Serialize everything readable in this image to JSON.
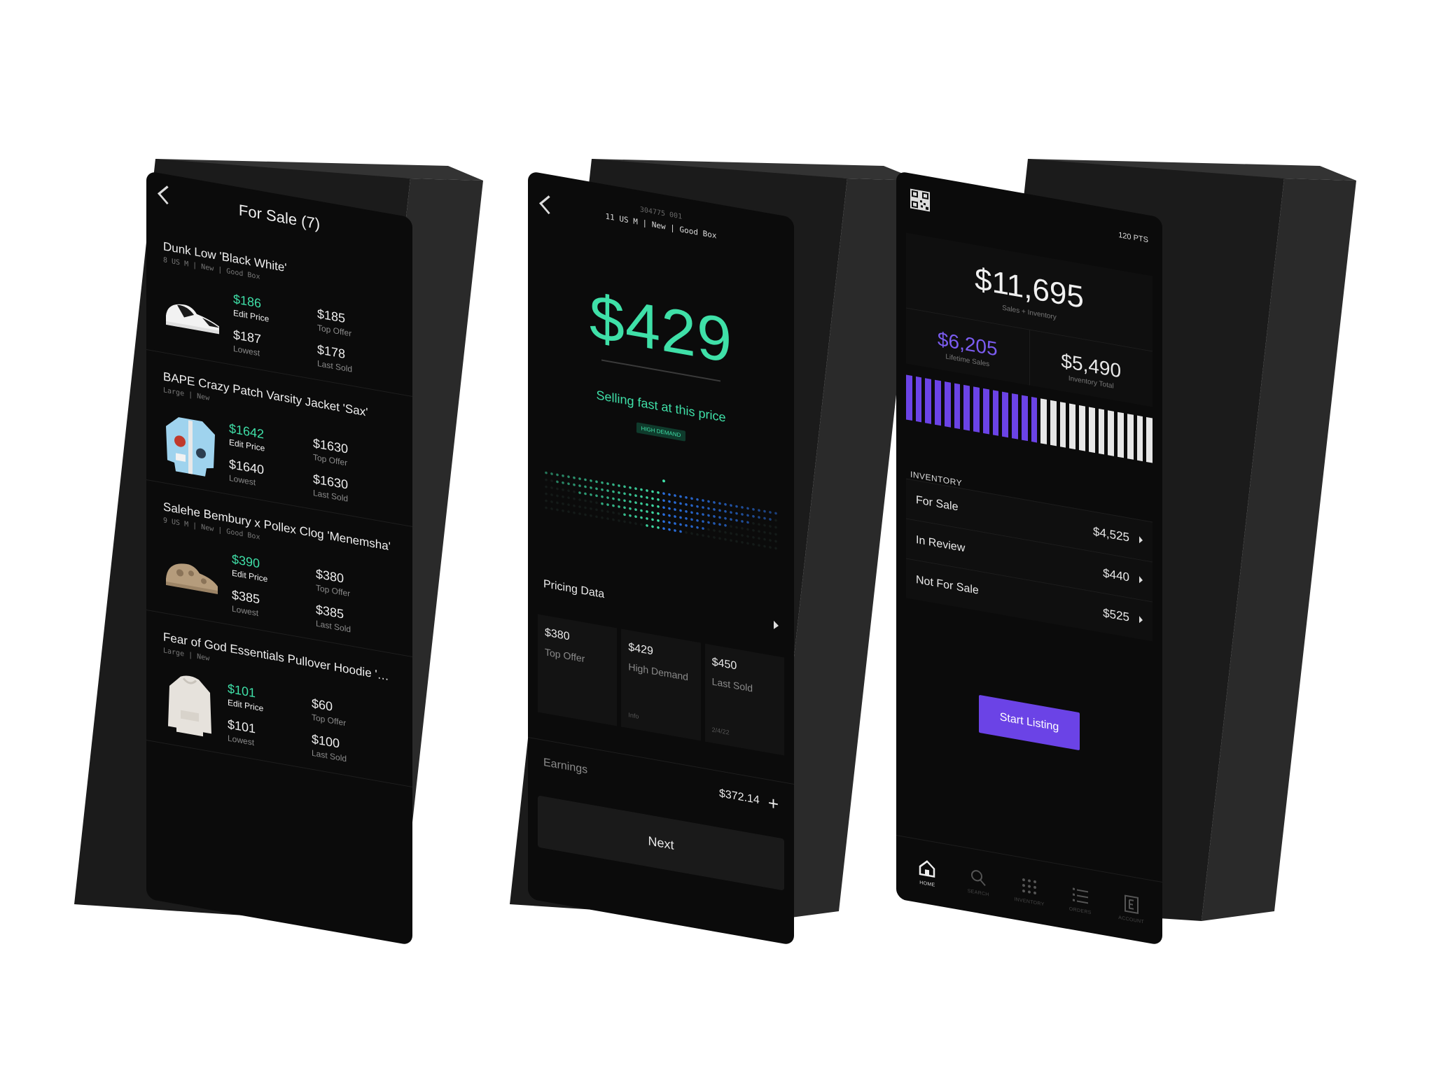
{
  "colors": {
    "accent_green": "#3fe0a8",
    "accent_purple": "#6b43e6",
    "accent_blue": "#2a6fe0",
    "screen_bg": "#0b0b0b",
    "device_body": "#1b1b1b"
  },
  "screen1": {
    "title": "For Sale (7)",
    "items": [
      {
        "name": "Dunk Low 'Black White'",
        "meta": "8 US M | New | Good Box",
        "thumb": "sneaker",
        "edit_price": "$186",
        "edit_label": "Edit Price",
        "top_offer": "$185",
        "top_offer_label": "Top Offer",
        "lowest": "$187",
        "lowest_label": "Lowest",
        "last_sold": "$178",
        "last_sold_label": "Last Sold"
      },
      {
        "name": "BAPE Crazy Patch Varsity Jacket 'Sax'",
        "meta": "Large | New",
        "thumb": "jacket",
        "edit_price": "$1642",
        "edit_label": "Edit Price",
        "top_offer": "$1630",
        "top_offer_label": "Top Offer",
        "lowest": "$1640",
        "lowest_label": "Lowest",
        "last_sold": "$1630",
        "last_sold_label": "Last Sold"
      },
      {
        "name": "Salehe Bembury x Pollex Clog 'Menemsha'",
        "meta": "9 US M | New | Good Box",
        "thumb": "clog",
        "edit_price": "$390",
        "edit_label": "Edit Price",
        "top_offer": "$380",
        "top_offer_label": "Top Offer",
        "lowest": "$385",
        "lowest_label": "Lowest",
        "last_sold": "$385",
        "last_sold_label": "Last Sold"
      },
      {
        "name": "Fear of God Essentials Pullover Hoodie 'Light Heather...",
        "meta": "Large | New",
        "thumb": "hoodie",
        "edit_price": "$101",
        "edit_label": "Edit Price",
        "top_offer": "$60",
        "top_offer_label": "Top Offer",
        "lowest": "$101",
        "lowest_label": "Lowest",
        "last_sold": "$100",
        "last_sold_label": "Last Sold"
      }
    ]
  },
  "screen2": {
    "id": "304775 001",
    "meta": "11 US M | New | Good Box",
    "price": "$429",
    "status": "Selling fast at this price",
    "badge": "HIGH DEMAND",
    "pricing_title": "Pricing Data",
    "cards": [
      {
        "value": "$380",
        "label": "Top Offer",
        "foot": ""
      },
      {
        "value": "$429",
        "label": "High Demand",
        "foot": "Info"
      },
      {
        "value": "$450",
        "label": "Last Sold",
        "foot": "2/4/22"
      }
    ],
    "earnings_label": "Earnings",
    "earnings_value": "$372.14",
    "next_label": "Next"
  },
  "screen3": {
    "points": "120 PTS",
    "total": "$11,695",
    "total_label": "Sales + Inventory",
    "lifetime": "$6,205",
    "lifetime_label": "Lifetime Sales",
    "inventory_total": "$5,490",
    "inventory_total_label": "Inventory Total",
    "bar_purple_fraction": 0.53,
    "inventory_heading": "INVENTORY",
    "rows": [
      {
        "label": "For Sale",
        "value": "$4,525"
      },
      {
        "label": "In Review",
        "value": "$440"
      },
      {
        "label": "Not For Sale",
        "value": "$525"
      }
    ],
    "start_label": "Start Listing",
    "tabs": [
      {
        "label": "HOME",
        "icon": "home-icon"
      },
      {
        "label": "SEARCH",
        "icon": "search-icon"
      },
      {
        "label": "INVENTORY",
        "icon": "grid-icon"
      },
      {
        "label": "ORDERS",
        "icon": "list-icon"
      },
      {
        "label": "ACCOUNT",
        "icon": "account-icon"
      }
    ]
  }
}
